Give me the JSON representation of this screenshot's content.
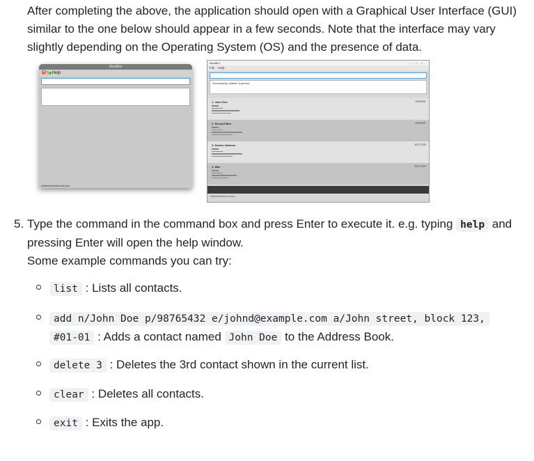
{
  "intro": "After completing the above, the application should open with a Graphical User Interface (GUI) similar to the one below should appear in a few seconds. Note that the interface may vary slightly depending on the Operating System (OS) and the presence of data.",
  "mac_shot": {
    "title": "MediBot",
    "menu": [
      "File",
      "Help"
    ],
    "footer": "./data/addressbook.json"
  },
  "win_shot": {
    "title": "MediBot",
    "menu": [
      "File",
      "Help"
    ],
    "result": "Successfully deleted a person",
    "cards": [
      {
        "name": "1. John Doe",
        "tag": "PATIENT"
      },
      {
        "name": "2. Second Man",
        "tag": "PATIENT"
      },
      {
        "name": "3. Doctor Jackson",
        "tag": "DOCTOR"
      },
      {
        "name": "4. Max",
        "tag": "DOCTOR"
      }
    ],
    "footer": "./data/addressbook.json"
  },
  "step": {
    "number": "5.",
    "text_before": "Type the command in the command box and press Enter to execute it. e.g. typing ",
    "code": "help",
    "text_after": " and pressing Enter will open the help window.",
    "line2": "Some example commands you can try:"
  },
  "examples": [
    {
      "code": "list",
      "desc": " : Lists all contacts."
    },
    {
      "code": "add n/John Doe p/98765432 e/johnd@example.com a/John street, block 123,",
      "code2": "#01-01",
      "desc": " : Adds a contact named ",
      "code3": "John Doe",
      "desc2": " to the Address Book."
    },
    {
      "code": "delete 3",
      "desc": " : Deletes the 3rd contact shown in the current list."
    },
    {
      "code": "clear",
      "desc": " : Deletes all contacts."
    },
    {
      "code": "exit",
      "desc": " : Exits the app."
    }
  ]
}
